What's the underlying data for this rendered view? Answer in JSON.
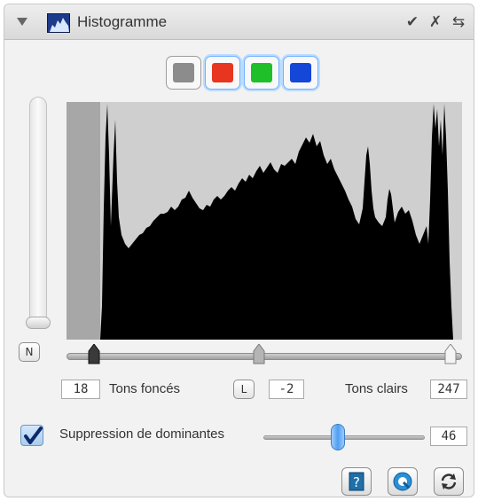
{
  "window": {
    "title": "Histogramme",
    "collapse_icon": "triangle-down-icon",
    "header_buttons": [
      "checkmark-icon",
      "close-x-icon",
      "panel-options-icon"
    ]
  },
  "channels": [
    {
      "name": "luminance",
      "color": "#8c8c8c"
    },
    {
      "name": "red",
      "color": "#e8351f"
    },
    {
      "name": "green",
      "color": "#1fbf2a"
    },
    {
      "name": "blue",
      "color": "#1446d8"
    }
  ],
  "left_button": "N",
  "levels": {
    "dark_value": "18",
    "dark_label": "Tons foncés",
    "l_button": "L",
    "gamma_value": "-2",
    "light_label": "Tons clairs",
    "light_value": "247"
  },
  "dominant": {
    "checked": true,
    "label": "Suppression de dominantes",
    "value": "46"
  },
  "tools": [
    "help-icon",
    "eyedropper-circle-icon",
    "reset-arrows-icon"
  ],
  "colors": {
    "histogram_fill": "#000000",
    "histogram_bg": "#cfcfcf",
    "accent": "#4f9ef0"
  }
}
